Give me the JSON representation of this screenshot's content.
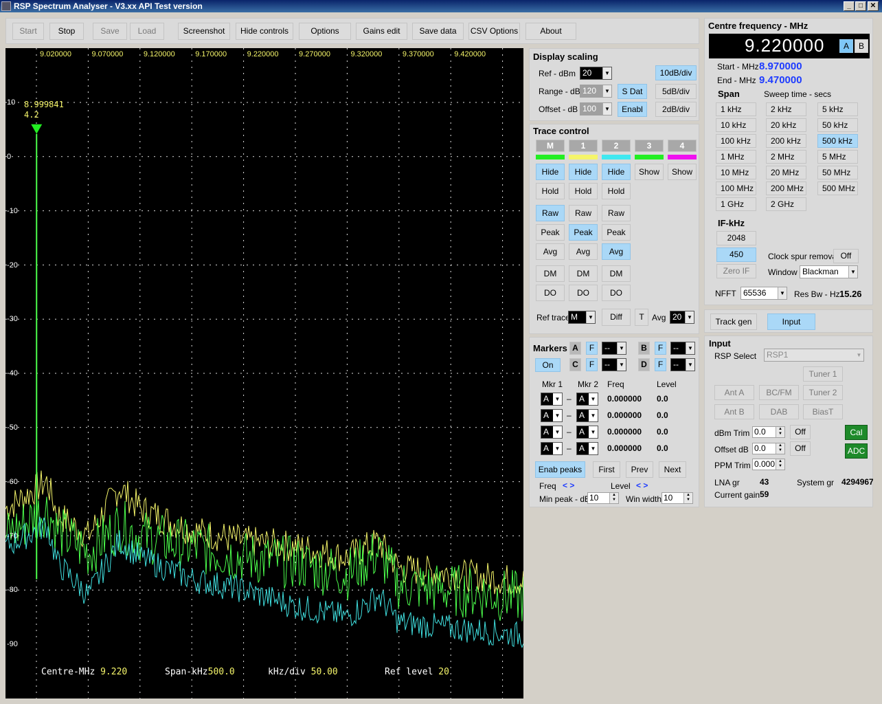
{
  "window": {
    "title": "RSP Spectrum Analyser - V3.xx API Test version"
  },
  "toolbar": {
    "start": "Start",
    "stop": "Stop",
    "save": "Save",
    "load": "Load",
    "screenshot": "Screenshot",
    "hide_controls": "Hide controls",
    "options": "Options",
    "gains_edit": "Gains edit",
    "save_data": "Save data",
    "csv_options": "CSV Options",
    "about": "About"
  },
  "plot": {
    "x_ticks": [
      "9.020000",
      "9.070000",
      "9.120000",
      "9.170000",
      "9.220000",
      "9.270000",
      "9.320000",
      "9.370000",
      "9.420000"
    ],
    "y_ticks": [
      "10",
      "0",
      "-10",
      "-20",
      "-30",
      "-40",
      "-50",
      "-60",
      "-70",
      "-80",
      "-90"
    ],
    "marker_freq": "8.999841",
    "marker_level": "4.2",
    "footer": {
      "centre_label": "Centre-MHz",
      "centre_value": "9.220",
      "span_label": "Span-kHz",
      "span_value": "500.0",
      "kdiv_label": "kHz/div",
      "kdiv_value": "50.00",
      "ref_label": "Ref level",
      "ref_value": "20"
    }
  },
  "chart_data": {
    "type": "line",
    "x": [
      9.0,
      9.01,
      9.02,
      9.05,
      9.08,
      9.1,
      9.15,
      9.2,
      9.25,
      9.3,
      9.33,
      9.35,
      9.4,
      9.45,
      9.5
    ],
    "series": [
      {
        "values": [
          4.2,
          -60,
          -66,
          -70,
          -61,
          -65,
          -69,
          -71,
          -72,
          -74,
          -71,
          -76,
          -77,
          -78,
          -79
        ]
      },
      {
        "values": [
          4.2,
          -65,
          -69,
          -73,
          -68,
          -70,
          -72,
          -74,
          -75,
          -77,
          -73,
          -79,
          -80,
          -81,
          -82
        ]
      },
      {
        "values": [
          4.2,
          -68,
          -75,
          -81,
          -71,
          -74,
          -78,
          -80,
          -83,
          -85,
          -81,
          -86,
          -87,
          -88,
          -89
        ]
      }
    ],
    "xlim": [
      8.97,
      9.47
    ],
    "ylim": [
      -100,
      20
    ],
    "grid": true,
    "line_colors": [
      "#f5f56a",
      "#4cff4c",
      "#40e0e0"
    ]
  },
  "display_scaling": {
    "title": "Display scaling",
    "ref_label": "Ref - dBm",
    "ref_value": "20",
    "range_label": "Range - dB",
    "range_value": "120",
    "offset_label": "Offset - dB",
    "offset_value": "100",
    "sdat": "S Dat",
    "enabl": "Enabl",
    "div10": "10dB/div",
    "div5": "5dB/div",
    "div2": "2dB/div"
  },
  "trace_control": {
    "title": "Trace control",
    "headers": [
      "M",
      "1",
      "2",
      "3",
      "4"
    ],
    "hide_show": [
      "Hide",
      "Hide",
      "Hide",
      "Show",
      "Show"
    ],
    "hold": "Hold",
    "raw": "Raw",
    "peak": "Peak",
    "avg": "Avg",
    "dm": "DM",
    "do": "DO",
    "ref_trace_label": "Ref trace",
    "ref_trace_value": "M",
    "diff": "Diff",
    "t": "T",
    "avg_label": "Avg",
    "avg_value": "20"
  },
  "markers": {
    "title": "Markers",
    "on": "On",
    "a": "A",
    "b": "B",
    "c": "C",
    "d": "D",
    "f": "F",
    "dash": "--",
    "mkr1": "Mkr 1",
    "mkr2": "Mkr 2",
    "freq": "Freq",
    "level": "Level",
    "rows": [
      {
        "m1": "A",
        "sep": "–",
        "m2": "A",
        "freq": "0.000000",
        "level": "0.0"
      },
      {
        "m1": "A",
        "sep": "–",
        "m2": "A",
        "freq": "0.000000",
        "level": "0.0"
      },
      {
        "m1": "A",
        "sep": "–",
        "m2": "A",
        "freq": "0.000000",
        "level": "0.0"
      },
      {
        "m1": "A",
        "sep": "–",
        "m2": "A",
        "freq": "0.000000",
        "level": "0.0"
      }
    ],
    "enab_peaks": "Enab peaks",
    "first": "First",
    "prev": "Prev",
    "next": "Next",
    "freq_label": "Freq",
    "level_label": "Level",
    "arrows": "< >",
    "min_peak_label": "Min peak - dB",
    "min_peak_value": "10",
    "win_width_label": "Win width",
    "win_width_value": "10"
  },
  "centre": {
    "title": "Centre frequency - MHz",
    "value": "9.220000",
    "a": "A",
    "b": "B",
    "start_label": "Start - MHz",
    "start_value": "8.970000",
    "end_label": "End - MHz",
    "end_value": "9.470000",
    "span_label": "Span",
    "sweep_label": "Sweep time - secs",
    "spans": [
      "1 kHz",
      "2 kHz",
      "5 kHz",
      "10 kHz",
      "20 kHz",
      "50 kHz",
      "100 kHz",
      "200 kHz",
      "500 kHz",
      "1 MHz",
      "2 MHz",
      "5 MHz",
      "10 MHz",
      "20 MHz",
      "50 MHz",
      "100 MHz",
      "200 MHz",
      "500 MHz",
      "1 GHz",
      "2 GHz"
    ],
    "if_label": "IF-kHz",
    "if_2048": "2048",
    "if_450": "450",
    "zero_if": "Zero IF",
    "clock_spur_label": "Clock spur removal",
    "clock_spur_value": "Off",
    "window_label": "Window",
    "window_value": "Blackman",
    "nfft_label": "NFFT",
    "nfft_value": "65536",
    "resbw_label": "Res Bw - Hz",
    "resbw_value": "15.26",
    "track_gen": "Track gen",
    "input": "Input"
  },
  "input": {
    "title": "Input",
    "rsp_select_label": "RSP Select",
    "rsp_select_value": "RSP1",
    "tuner1": "Tuner 1",
    "tuner2": "Tuner 2",
    "ant_a": "Ant A",
    "ant_b": "Ant B",
    "bcfm": "BC/FM",
    "dab": "DAB",
    "biast": "BiasT",
    "dbm_trim_label": "dBm Trim",
    "dbm_trim_value": "0.0",
    "offset_db_label": "Offset dB",
    "offset_db_value": "0.0",
    "ppm_trim_label": "PPM Trim",
    "ppm_trim_value": "0.000",
    "off": "Off",
    "cal": "Cal",
    "adc": "ADC",
    "lna_label": "LNA gr",
    "lna_value": "43",
    "system_label": "System gr",
    "system_value": "4294967",
    "current_label": "Current gain",
    "current_value": "59"
  },
  "colors": {
    "plot_bg": "#000000",
    "axis_text": "#f5f56a",
    "active_button": "#aad8f7"
  }
}
